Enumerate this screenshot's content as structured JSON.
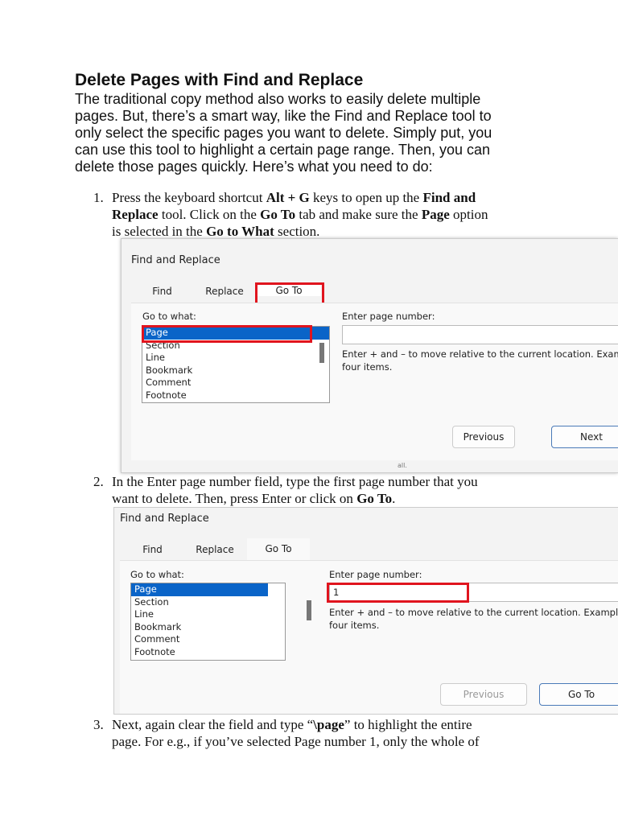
{
  "heading": "Delete Pages with Find and Replace",
  "paragraph": [
    "The traditional copy method also works to easily delete multiple",
    "pages. But, there’s a smart way, like the Find and Replace tool to",
    "only select the specific pages you want to delete. Simply put, you",
    "can use this tool to highlight a certain page range. Then, you can",
    "delete those pages quickly. Here’s what you need to do:"
  ],
  "steps": [
    {
      "num": "1.",
      "lines_html": [
        "Press the keyboard shortcut <b>Alt + G</b> keys to open up the <b>Find and</b>",
        "<b>Replace</b> tool. Click on the <b>Go To</b> tab and make sure the <b>Page</b> option",
        "is selected in the <b>Go to What</b> section."
      ]
    },
    {
      "num": "2.",
      "lines_html": [
        "In the Enter page number field, type the first page number that you",
        "want to delete. Then, press Enter or click on <b>Go To</b>."
      ]
    },
    {
      "num": "3.",
      "lines_html": [
        "Next, again clear the field and type “<b>\\page</b>” to highlight the entire",
        "page. For e.g., if you’ve selected Page number 1, only the whole of"
      ]
    }
  ],
  "dialog1": {
    "title": "Find and Replace",
    "tabs": [
      "Find",
      "Replace",
      "Go To"
    ],
    "go_to_what_label": "Go to what:",
    "items": [
      "Page",
      "Section",
      "Line",
      "Bookmark",
      "Comment",
      "Footnote"
    ],
    "enter_label": "Enter page number:",
    "input_value": "",
    "help": [
      "Enter + and – to move relative to the current location. Examp",
      "four items."
    ],
    "previous": "Previous",
    "next": "Next",
    "fragment": "all."
  },
  "dialog2": {
    "title": "Find and Replace",
    "tabs": [
      "Find",
      "Replace",
      "Go To"
    ],
    "go_to_what_label": "Go to what:",
    "items": [
      "Page",
      "Section",
      "Line",
      "Bookmark",
      "Comment",
      "Footnote"
    ],
    "enter_label": "Enter page number:",
    "input_value": "1",
    "help": [
      "Enter + and – to move relative to the current location. Example:",
      "four items."
    ],
    "previous": "Previous",
    "goto": "Go To"
  },
  "colors": {
    "highlight_red": "#e0141e",
    "selection_blue": "#0a64c8"
  }
}
